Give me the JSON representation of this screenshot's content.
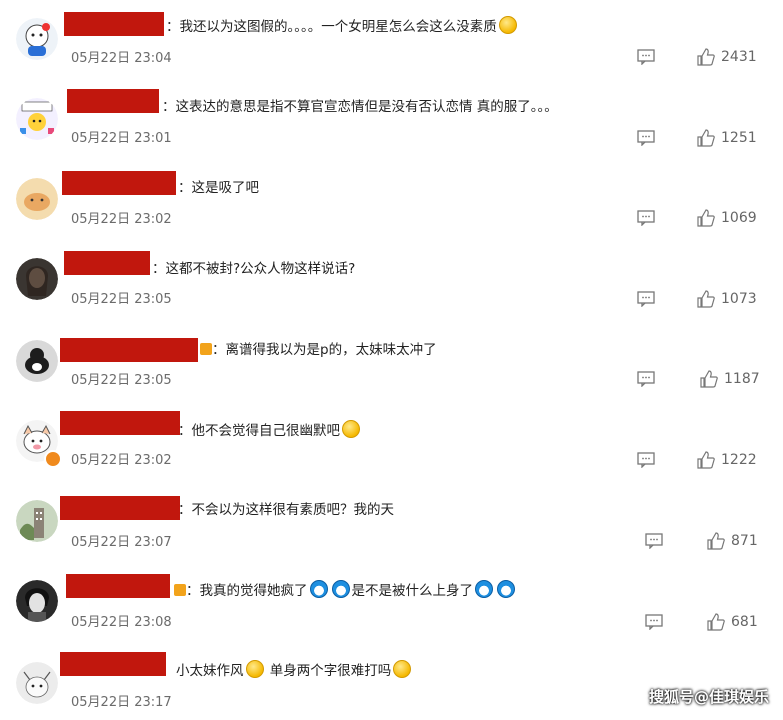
{
  "colors": {
    "redact": "#c1170d",
    "text": "#222222",
    "meta": "#6b6b6b"
  },
  "comments": [
    {
      "text": "：我还以为这图假的。。。。一个女明星怎么会这么没素质",
      "time": "05月22日 23:04",
      "likes": "2431"
    },
    {
      "text": "：这表达的意思是指不算官宣恋情但是没有否认恋情 真的服了。。。",
      "time": "05月22日 23:01",
      "likes": "1251"
    },
    {
      "text": "：这是吸了吧",
      "time": "05月22日 23:02",
      "likes": "1069"
    },
    {
      "text": "：这都不被封?公众人物这样说话?",
      "time": "05月22日 23:05",
      "likes": "1073"
    },
    {
      "text": "：离谱得我以为是p的，太妹味太冲了",
      "time": "05月22日 23:05",
      "likes": "1187"
    },
    {
      "text": "：他不会觉得自己很幽默吧",
      "time": "05月22日 23:02",
      "likes": "1222"
    },
    {
      "text": "：不会以为这样很有素质吧？我的天",
      "time": "05月22日 23:07",
      "likes": "871"
    },
    {
      "text_a": "：我真的觉得她疯了",
      "text_b": "是不是被什么上身了",
      "time": "05月22日 23:08",
      "likes": "681"
    },
    {
      "text_a": "小太妹作风",
      "text_b": "单身两个字很难打吗",
      "time": "05月22日 23:17"
    }
  ],
  "watermark": "搜狐号@佳琪娱乐"
}
